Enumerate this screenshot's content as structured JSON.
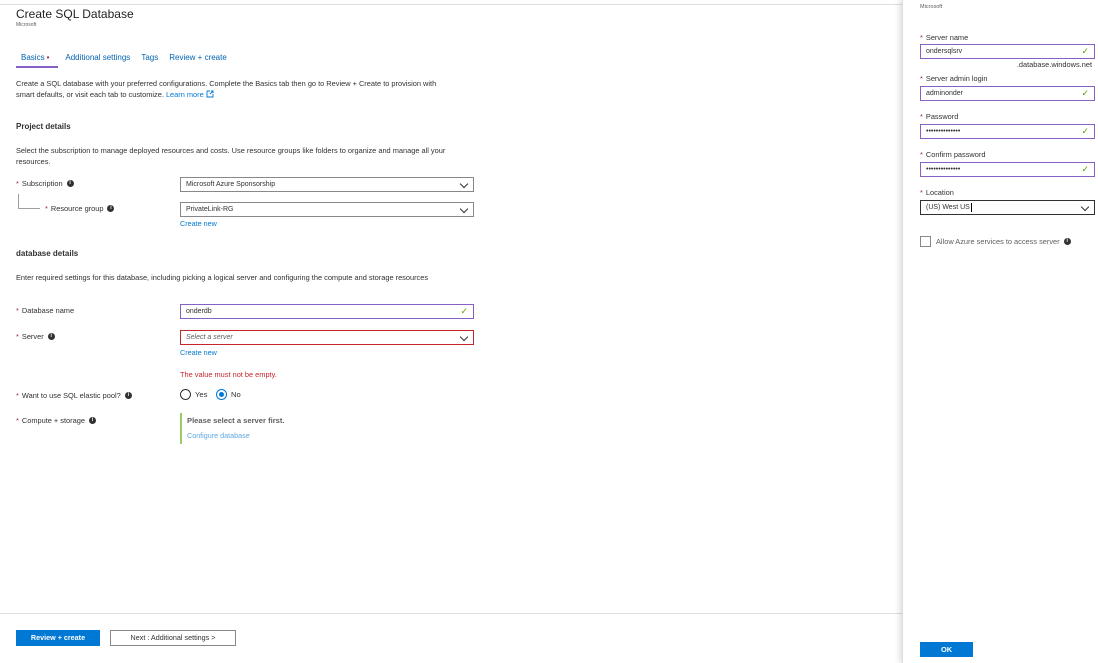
{
  "header": {
    "title": "Create SQL Database",
    "subtitle": "Microsoft"
  },
  "tabs": [
    {
      "label": "Basics",
      "active": true,
      "required_marker": "•"
    },
    {
      "label": "Additional settings"
    },
    {
      "label": "Tags"
    },
    {
      "label": "Review + create"
    }
  ],
  "intro": {
    "text": "Create a SQL database with your preferred configurations. Complete the Basics tab then go to Review + Create to provision with smart defaults, or visit each tab to customize.",
    "learn_more": "Learn more"
  },
  "project": {
    "heading": "Project details",
    "description": "Select the subscription to manage deployed resources and costs. Use resource groups like folders to organize and manage all your resources.",
    "subscription_label": "Subscription",
    "subscription_value": "Microsoft Azure Sponsorship",
    "resource_group_label": "Resource group",
    "resource_group_value": "PrivateLink-RG",
    "create_new": "Create new"
  },
  "database": {
    "heading": "database details",
    "description": "Enter required settings for this database, including picking a logical server and configuring the compute and storage resources",
    "name_label": "Database name",
    "name_value": "onderdb",
    "server_label": "Server",
    "server_placeholder": "Select a server",
    "server_create_new": "Create new",
    "server_error": "The value must not be empty.",
    "elastic_label": "Want to use SQL elastic pool?",
    "elastic_yes": "Yes",
    "elastic_no": "No",
    "compute_label": "Compute + storage",
    "compute_note": "Please select a server first.",
    "compute_link": "Configure database"
  },
  "footer": {
    "review_create": "Review + create",
    "next": "Next : Additional settings >"
  },
  "panel": {
    "subtitle": "Microsoft",
    "server_name_label": "Server name",
    "server_name_value": "ondersqlsrv",
    "server_suffix": ".database.windows.net",
    "admin_label": "Server admin login",
    "admin_value": "adminonder",
    "password_label": "Password",
    "password_value": "••••••••••••••",
    "confirm_label": "Confirm password",
    "confirm_value": "••••••••••••••",
    "location_label": "Location",
    "location_value": "(US) West US",
    "allow_azure_label": "Allow Azure services to access server",
    "ok": "OK"
  },
  "required_star": "*",
  "check_mark": "✓",
  "info_glyph": "i",
  "external_icon": "external-link-icon",
  "colors": {
    "accent": "#0078d4",
    "valid": "#57a300",
    "error": "#c5262c",
    "tab_underline": "#8661c5"
  }
}
